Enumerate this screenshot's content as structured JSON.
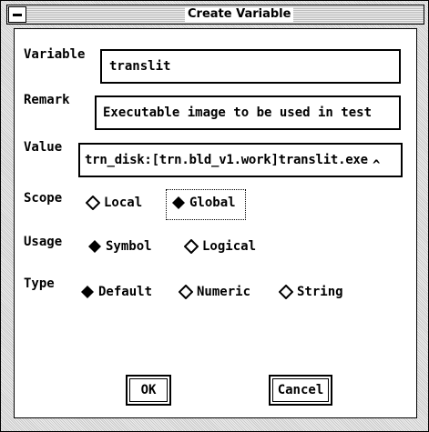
{
  "window": {
    "title": "Create Variable"
  },
  "form": {
    "variable": {
      "label": "Variable",
      "value": "translit"
    },
    "remark": {
      "label": "Remark",
      "value": "Executable image to be used in test"
    },
    "value": {
      "label": "Value",
      "value": "trn_disk:[trn.bld_v1.work]translit.exe",
      "caret": "^"
    },
    "scope": {
      "label": "Scope",
      "options": [
        "Local",
        "Global"
      ],
      "selected": "Global"
    },
    "usage": {
      "label": "Usage",
      "options": [
        "Symbol",
        "Logical"
      ],
      "selected": "Symbol"
    },
    "type": {
      "label": "Type",
      "options": [
        "Default",
        "Numeric",
        "String"
      ],
      "selected": "Default"
    }
  },
  "buttons": {
    "ok": "OK",
    "cancel": "Cancel"
  },
  "icons": {
    "window_menu": "window-menu-icon",
    "radio_on": "filled-diamond-icon",
    "radio_off": "hollow-diamond-icon"
  }
}
